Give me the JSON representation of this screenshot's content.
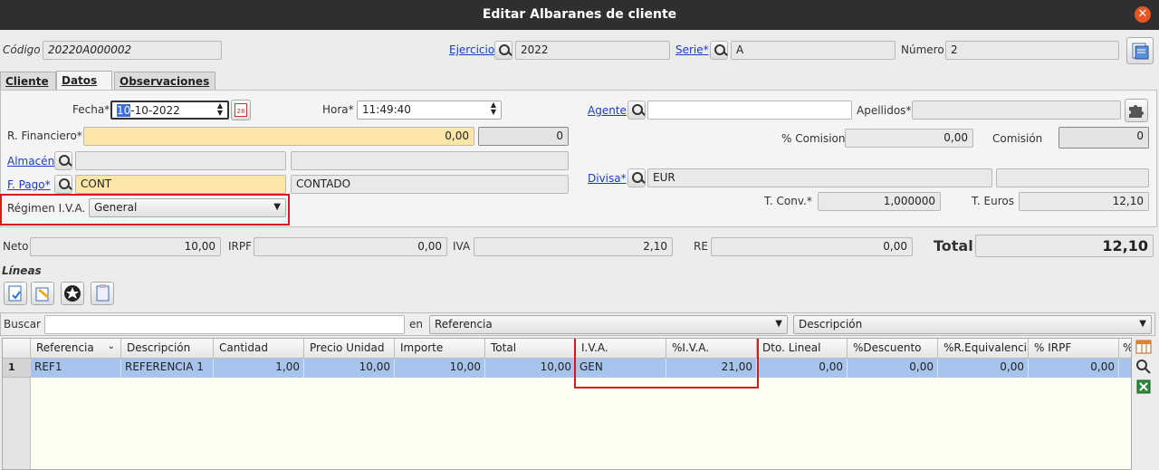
{
  "window": {
    "title": "Editar Albaranes de cliente",
    "close_glyph": "✕"
  },
  "header": {
    "codigo_label": "Código",
    "codigo_value": "20220A000002",
    "ejercicio_label": "Ejercicio",
    "ejercicio_value": "2022",
    "serie_label": "Serie*",
    "serie_value": "A",
    "numero_label": "Número",
    "numero_value": "2"
  },
  "tabs": [
    {
      "label": "Cliente",
      "active": false
    },
    {
      "label": "Datos",
      "active": true
    },
    {
      "label": "Observaciones",
      "active": false
    }
  ],
  "datos": {
    "fecha_label": "Fecha*",
    "fecha_value_sel": "10",
    "fecha_value_rest": "-10-2022",
    "calendar_day": "28",
    "hora_label": "Hora*",
    "hora_value": "11:49:40",
    "rfin_label": "R. Financiero*",
    "rfin_value": "0,00",
    "rfin_extra": "0",
    "almacen_label": "Almacén",
    "almacen_value": "",
    "almacen_desc": "",
    "fpago_label": "F. Pago*",
    "fpago_value": "CONT",
    "fpago_desc": "CONTADO",
    "regimen_label": "Régimen I.V.A.",
    "regimen_value": "General",
    "agente_label": "Agente",
    "agente_value": "",
    "apellidos_label": "Apellidos*",
    "apellidos_value": "",
    "pcomision_label": "% Comision",
    "pcomision_value": "0,00",
    "comision_label": "Comisión",
    "comision_value": "0",
    "divisa_label": "Divisa*",
    "divisa_value": "EUR",
    "divisa_desc": "",
    "tconv_label": "T. Conv.*",
    "tconv_value": "1,000000",
    "teuros_label": "T. Euros",
    "teuros_value": "12,10"
  },
  "totals": {
    "neto_label": "Neto",
    "neto_value": "10,00",
    "irpf_label": "IRPF",
    "irpf_value": "0,00",
    "iva_label": "IVA",
    "iva_value": "2,10",
    "re_label": "RE",
    "re_value": "0,00",
    "total_label": "Total",
    "total_value": "12,10"
  },
  "lineas": {
    "section_label": "Líneas",
    "search_label": "Buscar",
    "search_value": "",
    "en_label": "en",
    "field_select": "Referencia",
    "order_select": "Descripción",
    "columns": [
      "Referencia",
      "Descripción",
      "Cantidad",
      "Precio Unidad",
      "Importe",
      "Total",
      "I.V.A.",
      "%I.V.A.",
      "Dto. Lineal",
      "%Descuento",
      "%R.Equivalencia",
      "% IRPF",
      "%"
    ],
    "rows": [
      {
        "num": "1",
        "cells": [
          "REF1",
          "REFERENCIA 1",
          "1,00",
          "10,00",
          "10,00",
          "10,00",
          "GEN",
          "21,00",
          "0,00",
          "0,00",
          "0,00",
          "0,00"
        ]
      }
    ]
  },
  "colors": {
    "accent_link": "#1a3cc8",
    "highlight_box": "#d41a1a",
    "required_field": "#fde6a8",
    "selected_row": "#a7c4ec"
  }
}
